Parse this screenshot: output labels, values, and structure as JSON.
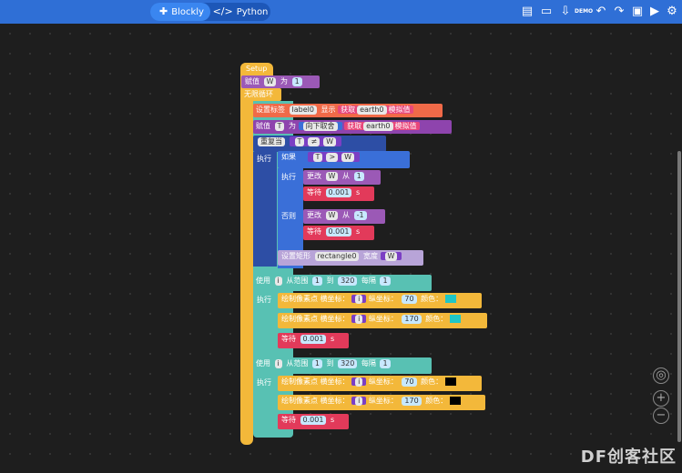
{
  "toolbar": {
    "blockly_label": "Blockly",
    "python_label": "Python",
    "icons": [
      "document-icon",
      "chat-icon",
      "download-icon",
      "demo-icon",
      "undo-icon",
      "redo-icon",
      "capture-icon",
      "run-icon",
      "settings-icon"
    ],
    "demo_text": "DEMO"
  },
  "blocks": {
    "setup": "Setup",
    "assign1": {
      "label": "赋值",
      "var": "W",
      "op": "为",
      "val": "1"
    },
    "loop": "无限循环",
    "setlabel": {
      "label": "设置标签",
      "target": "label0",
      "show": "显示",
      "get": "获取",
      "src": "earth0",
      "suffix": "模拟值"
    },
    "assign2": {
      "label": "赋值",
      "var": "T",
      "op": "为",
      "fn": "向下取舍",
      "get": "获取",
      "src": "earth0",
      "suffix": "模拟值"
    },
    "repeat": {
      "label": "重复当",
      "a": "T",
      "op": "≠",
      "b": "W"
    },
    "exec": "执行",
    "if": {
      "label": "如果",
      "a": "T",
      "op": ">",
      "b": "W"
    },
    "change1": {
      "label": "更改",
      "var": "W",
      "from": "从",
      "val": "1"
    },
    "wait1": {
      "label": "等待",
      "val": "0.001",
      "unit": "s"
    },
    "else": "否则",
    "change2": {
      "label": "更改",
      "var": "W",
      "from": "从",
      "val": "-1"
    },
    "wait2": {
      "label": "等待",
      "val": "0.001",
      "unit": "s"
    },
    "setrect": {
      "label": "设置矩形",
      "target": "rectangle0",
      "width": "宽度",
      "var": "W"
    },
    "for1": {
      "use": "使用",
      "var": "i",
      "range": "从范围",
      "start": "1",
      "to": "到",
      "end": "320",
      "step": "每隔",
      "stepval": "1"
    },
    "draw1": {
      "label": "绘制像素点 横坐标：",
      "x": "i",
      "ylabel": "纵坐标：",
      "y": "70",
      "color": "颜色：",
      "colorval": "#1fc6c6"
    },
    "draw2": {
      "label": "绘制像素点 横坐标：",
      "x": "i",
      "ylabel": "纵坐标：",
      "y": "170",
      "color": "颜色：",
      "colorval": "#1fc6c6"
    },
    "wait3": {
      "label": "等待",
      "val": "0.001",
      "unit": "s"
    },
    "for2": {
      "use": "使用",
      "var": "i",
      "range": "从范围",
      "start": "1",
      "to": "到",
      "end": "320",
      "step": "每隔",
      "stepval": "1"
    },
    "draw3": {
      "label": "绘制像素点 横坐标：",
      "x": "i",
      "ylabel": "纵坐标：",
      "y": "70",
      "color": "颜色：",
      "colorval": "#000000"
    },
    "draw4": {
      "label": "绘制像素点 横坐标：",
      "x": "i",
      "ylabel": "纵坐标：",
      "y": "170",
      "color": "颜色：",
      "colorval": "#000000"
    },
    "wait4": {
      "label": "等待",
      "val": "0.001",
      "unit": "s"
    }
  },
  "watermark": "DF创客社区"
}
